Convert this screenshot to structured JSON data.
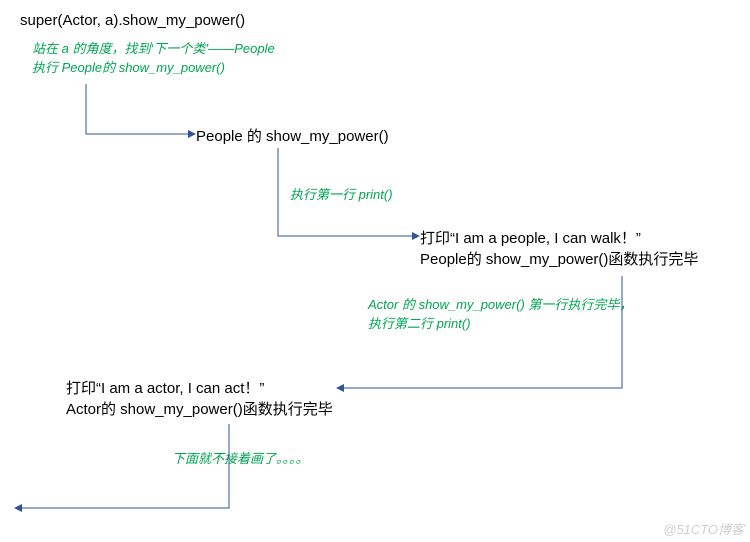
{
  "nodes": {
    "node1": "super(Actor, a).show_my_power()",
    "node2": "People 的 show_my_power()",
    "node3_line1": "打印“I am a people, I can walk！”",
    "node3_line2": "People的 show_my_power()函数执行完毕",
    "node4_line1": "打印“I am a actor, I can act！”",
    "node4_line2": "Actor的 show_my_power()函数执行完毕"
  },
  "comments": {
    "c1_line1": "站在 a 的角度，找到‘下一个类’——People",
    "c1_line2": "执行 People的 show_my_power()",
    "c2": "执行第一行 print()",
    "c3_line1": "Actor 的 show_my_power() 第一行执行完毕，",
    "c3_line2": "执行第二行 print()",
    "c4": "下面就不接着画了。。。。"
  },
  "watermark": "@51CTO博客"
}
